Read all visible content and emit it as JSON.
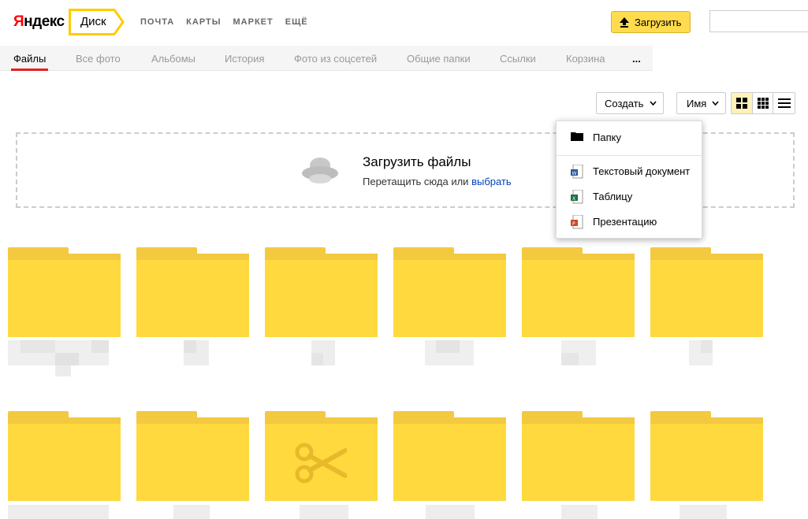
{
  "header": {
    "logo_first": "Я",
    "logo_rest": "ндекс",
    "service_name": "Диск",
    "nav": [
      "ПОЧТА",
      "КАРТЫ",
      "МАРКЕТ",
      "ЕЩЁ"
    ],
    "upload_label": "Загрузить"
  },
  "tabs": [
    {
      "label": "Файлы"
    },
    {
      "label": "Все фото"
    },
    {
      "label": "Альбомы"
    },
    {
      "label": "История"
    },
    {
      "label": "Фото из соцсетей"
    },
    {
      "label": "Общие папки"
    },
    {
      "label": "Ссылки"
    },
    {
      "label": "Корзина"
    },
    {
      "label": "..."
    }
  ],
  "toolbar": {
    "create_label": "Создать",
    "sort_label": "Имя"
  },
  "dropzone": {
    "title": "Загрузить файлы",
    "subtitle_text": "Перетащить сюда или ",
    "subtitle_link": "выбрать"
  },
  "create_menu": {
    "items": [
      {
        "label": "Папку",
        "icon": "folder-icon"
      },
      {
        "label": "Текстовый документ",
        "icon": "word-doc-icon"
      },
      {
        "label": "Таблицу",
        "icon": "excel-sheet-icon"
      },
      {
        "label": "Презентацию",
        "icon": "powerpoint-icon"
      }
    ]
  },
  "colors": {
    "accent_yellow": "#ffdb4d",
    "folder_yellow": "#ffd93d",
    "active_tab_underline": "#e52020",
    "link_blue": "#0044bb"
  }
}
